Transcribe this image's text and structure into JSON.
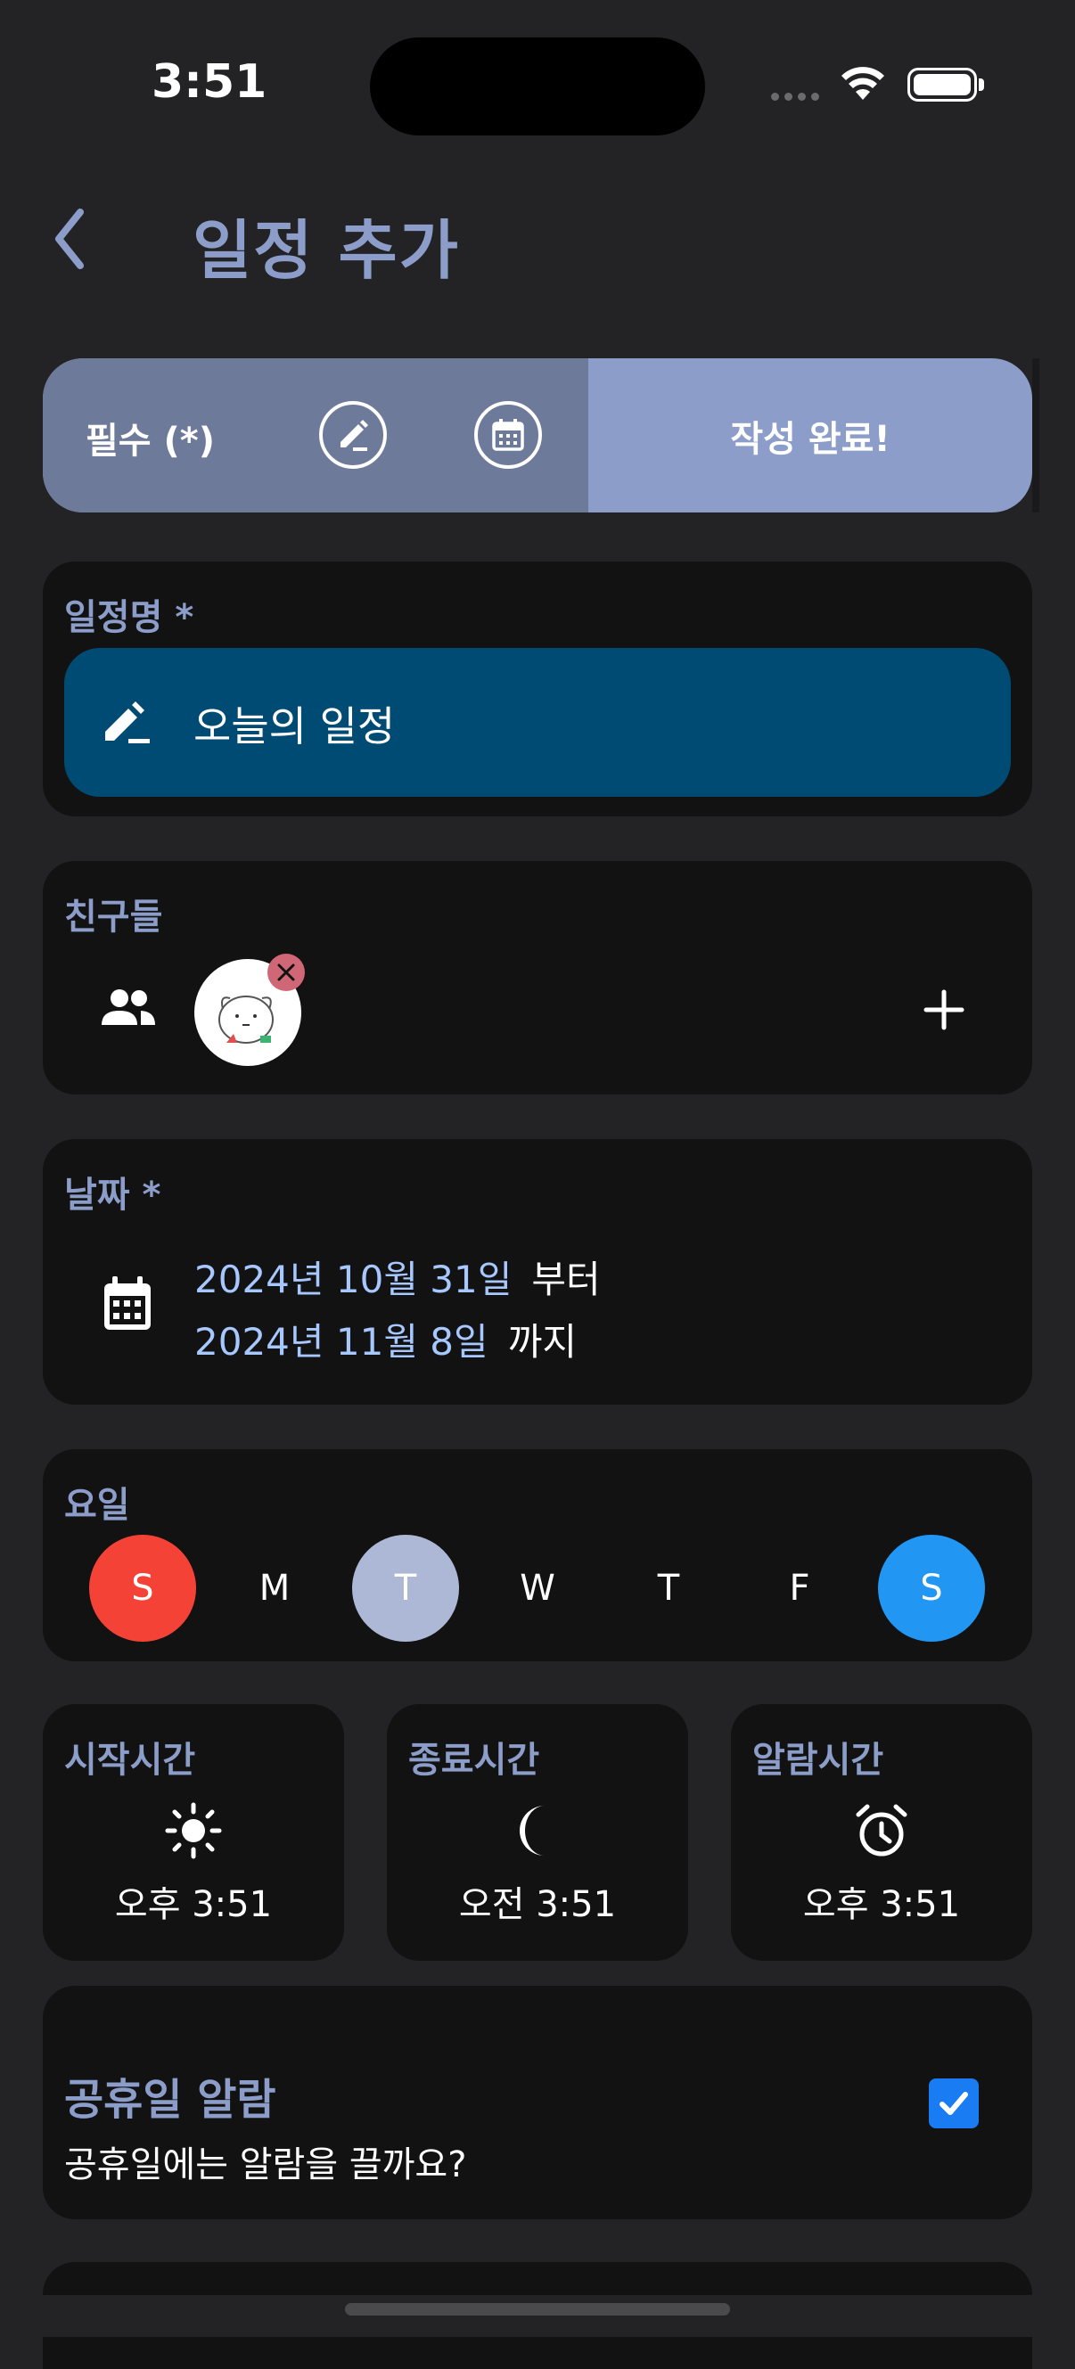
{
  "status": {
    "time": "3:51"
  },
  "header": {
    "title": "일정 추가",
    "back_icon": "chevron-left-icon"
  },
  "stepbar": {
    "required_label": "필수 (*)",
    "icons": [
      "edit-icon",
      "calendar-icon"
    ],
    "done_label": "작성 완료!",
    "colors": {
      "left": "#6d7a99",
      "right": "#8b9dc8"
    }
  },
  "schedule_name": {
    "label": "일정명 *",
    "value": "오늘의 일정",
    "icon": "edit-icon"
  },
  "friends": {
    "label": "친구들",
    "icon": "people-icon",
    "add_icon": "plus-icon"
  },
  "date": {
    "label": "날짜 *",
    "start": "2024년 10월 31일",
    "start_suffix": "부터",
    "end": "2024년 11월 8일",
    "end_suffix": "까지"
  },
  "weekdays": {
    "label": "요일",
    "days": [
      {
        "letter": "S",
        "color": "#f44336"
      },
      {
        "letter": "M",
        "color": ""
      },
      {
        "letter": "T",
        "color": "#adb8d6"
      },
      {
        "letter": "W",
        "color": ""
      },
      {
        "letter": "T",
        "color": ""
      },
      {
        "letter": "F",
        "color": ""
      },
      {
        "letter": "S",
        "color": "#2196f3"
      }
    ]
  },
  "times": {
    "start": {
      "label": "시작시간",
      "value": "오후 3:51",
      "icon": "sun-icon"
    },
    "end": {
      "label": "종료시간",
      "value": "오전 3:51",
      "icon": "moon-icon"
    },
    "alarm": {
      "label": "알람시간",
      "value": "오후 3:51",
      "icon": "alarm-clock-icon"
    }
  },
  "holiday": {
    "title": "공휴일 알람",
    "description": "공휴일에는 알람을 끌까요?",
    "checked": true
  }
}
